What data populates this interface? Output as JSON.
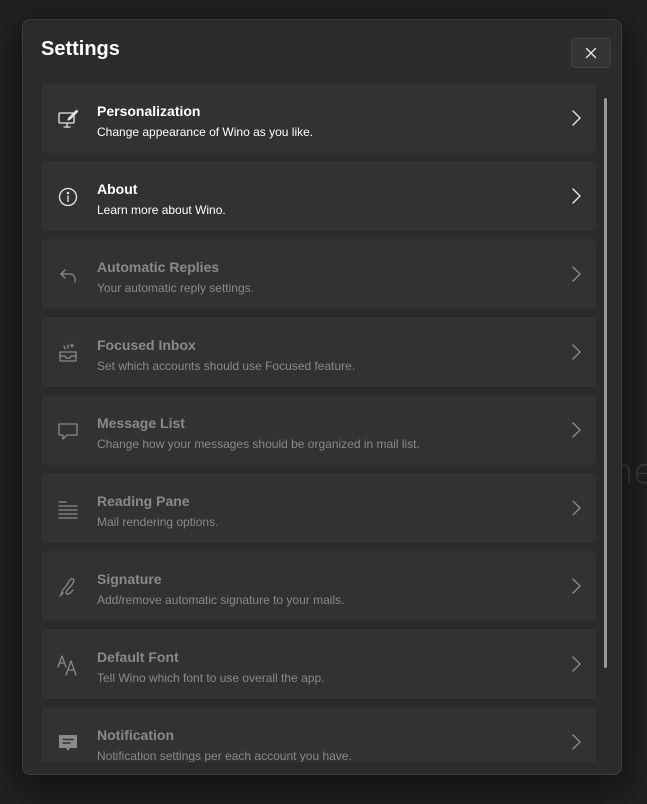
{
  "background": {
    "text": "nes"
  },
  "dialog": {
    "title": "Settings",
    "close_icon": "close-icon"
  },
  "colors": {
    "background": "#202020",
    "dialog": "#2b2b2b",
    "item": "#323232",
    "text_primary": "#ffffff",
    "text_disabled": "#8a8a8a"
  },
  "items": [
    {
      "label": "Personalization",
      "desc": "Change appearance of Wino as you like.",
      "icon": "paint-monitor-icon",
      "enabled": true
    },
    {
      "label": "About",
      "desc": "Learn more about Wino.",
      "icon": "info-icon",
      "enabled": true
    },
    {
      "label": "Automatic Replies",
      "desc": "Your automatic reply settings.",
      "icon": "reply-icon",
      "enabled": false
    },
    {
      "label": "Focused Inbox",
      "desc": "Set which accounts should use Focused feature.",
      "icon": "focused-inbox-icon",
      "enabled": false
    },
    {
      "label": "Message List",
      "desc": "Change how your messages should be organized in mail list.",
      "icon": "message-list-icon",
      "enabled": false
    },
    {
      "label": "Reading Pane",
      "desc": "Mail rendering options.",
      "icon": "reading-pane-icon",
      "enabled": false
    },
    {
      "label": "Signature",
      "desc": "Add/remove automatic signature to your mails.",
      "icon": "signature-icon",
      "enabled": false
    },
    {
      "label": "Default Font",
      "desc": "Tell Wino which font to use overall the app.",
      "icon": "font-icon",
      "enabled": false
    },
    {
      "label": "Notification",
      "desc": "Notification settings per each account you have.",
      "icon": "notification-icon",
      "enabled": false
    }
  ]
}
